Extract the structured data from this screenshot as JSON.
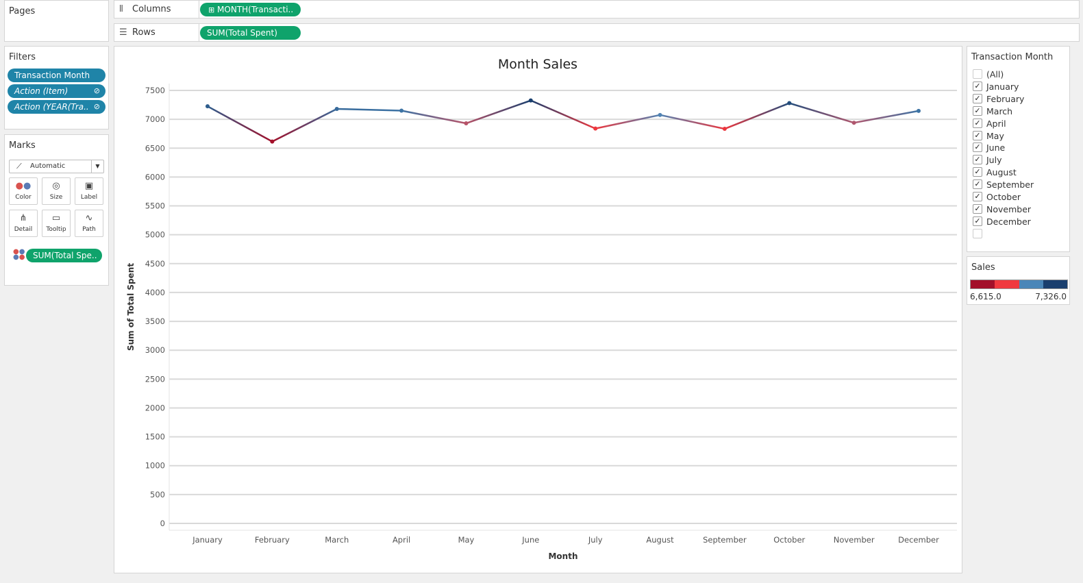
{
  "pages_panel": {
    "title": "Pages"
  },
  "columns_shelf": {
    "label": "Columns",
    "pill": "MONTH(Transacti.."
  },
  "rows_shelf": {
    "label": "Rows",
    "pill": "SUM(Total Spent)"
  },
  "filters": {
    "title": "Filters",
    "items": [
      "Transaction Month",
      "Action (Item)",
      "Action (YEAR(Tra.."
    ]
  },
  "marks": {
    "title": "Marks",
    "mark_type": "Automatic",
    "buttons": [
      "Color",
      "Size",
      "Label",
      "Detail",
      "Tooltip",
      "Path"
    ],
    "color_pill": "SUM(Total Spe.."
  },
  "filter_card": {
    "title": "Transaction Month",
    "options": [
      {
        "label": "(All)",
        "checked": false
      },
      {
        "label": "January",
        "checked": true
      },
      {
        "label": "February",
        "checked": true
      },
      {
        "label": "March",
        "checked": true
      },
      {
        "label": "April",
        "checked": true
      },
      {
        "label": "May",
        "checked": true
      },
      {
        "label": "June",
        "checked": true
      },
      {
        "label": "July",
        "checked": true
      },
      {
        "label": "August",
        "checked": true
      },
      {
        "label": "September",
        "checked": true
      },
      {
        "label": "October",
        "checked": true
      },
      {
        "label": "November",
        "checked": true
      },
      {
        "label": "December",
        "checked": true
      },
      {
        "label": "",
        "checked": false
      }
    ]
  },
  "legend": {
    "title": "Sales",
    "min_label": "6,615.0",
    "max_label": "7,326.0",
    "colors": [
      "#a3102a",
      "#f0393f",
      "#4a86b8",
      "#1a3f6e"
    ]
  },
  "chart_data": {
    "type": "line",
    "title": "Month Sales",
    "xlabel": "Month",
    "ylabel": "Sum of Total Spent",
    "categories": [
      "January",
      "February",
      "March",
      "April",
      "May",
      "June",
      "July",
      "August",
      "September",
      "October",
      "November",
      "December"
    ],
    "series": [
      {
        "values": [
          7225,
          6615,
          7180,
          7150,
          6930,
          7326,
          6840,
          7075,
          6835,
          7280,
          6940,
          7145
        ]
      }
    ],
    "ylim": [
      0,
      7500
    ],
    "yticks": [
      0,
      500,
      1000,
      1500,
      2000,
      2500,
      3000,
      3500,
      4000,
      4500,
      5000,
      5500,
      6000,
      6500,
      7000,
      7500
    ],
    "grid": true,
    "color_scale": {
      "min": 6615,
      "max": 7326
    }
  }
}
